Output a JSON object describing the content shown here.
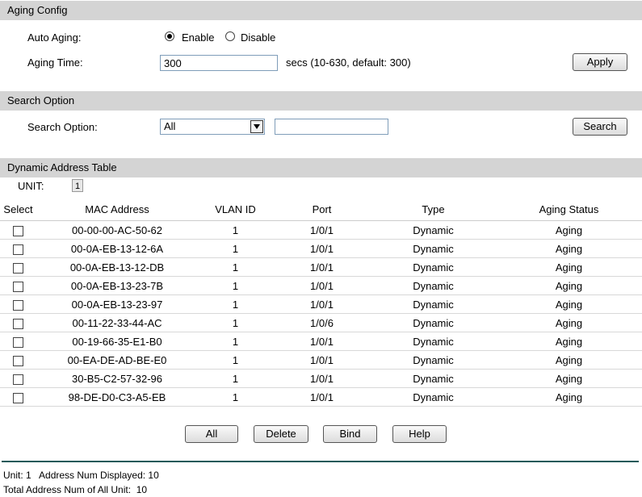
{
  "aging_config": {
    "header": "Aging Config",
    "auto_aging_label": "Auto Aging:",
    "enable_label": "Enable",
    "disable_label": "Disable",
    "auto_aging_selected": "Enable",
    "aging_time_label": "Aging Time:",
    "aging_time_value": "300",
    "aging_time_hint": "secs (10-630, default: 300)",
    "apply_label": "Apply"
  },
  "search": {
    "header": "Search Option",
    "option_label": "Search Option:",
    "option_selected": "All",
    "search_value": "",
    "search_button": "Search"
  },
  "dynamic_table": {
    "header": "Dynamic Address Table",
    "unit_label": "UNIT:",
    "unit_value": "1",
    "columns": [
      "Select",
      "MAC Address",
      "VLAN ID",
      "Port",
      "Type",
      "Aging Status"
    ],
    "rows": [
      {
        "mac": "00-00-00-AC-50-62",
        "vlan": "1",
        "port": "1/0/1",
        "type": "Dynamic",
        "status": "Aging"
      },
      {
        "mac": "00-0A-EB-13-12-6A",
        "vlan": "1",
        "port": "1/0/1",
        "type": "Dynamic",
        "status": "Aging"
      },
      {
        "mac": "00-0A-EB-13-12-DB",
        "vlan": "1",
        "port": "1/0/1",
        "type": "Dynamic",
        "status": "Aging"
      },
      {
        "mac": "00-0A-EB-13-23-7B",
        "vlan": "1",
        "port": "1/0/1",
        "type": "Dynamic",
        "status": "Aging"
      },
      {
        "mac": "00-0A-EB-13-23-97",
        "vlan": "1",
        "port": "1/0/1",
        "type": "Dynamic",
        "status": "Aging"
      },
      {
        "mac": "00-11-22-33-44-AC",
        "vlan": "1",
        "port": "1/0/6",
        "type": "Dynamic",
        "status": "Aging"
      },
      {
        "mac": "00-19-66-35-E1-B0",
        "vlan": "1",
        "port": "1/0/1",
        "type": "Dynamic",
        "status": "Aging"
      },
      {
        "mac": "00-EA-DE-AD-BE-E0",
        "vlan": "1",
        "port": "1/0/1",
        "type": "Dynamic",
        "status": "Aging"
      },
      {
        "mac": "30-B5-C2-57-32-96",
        "vlan": "1",
        "port": "1/0/1",
        "type": "Dynamic",
        "status": "Aging"
      },
      {
        "mac": "98-DE-D0-C3-A5-EB",
        "vlan": "1",
        "port": "1/0/1",
        "type": "Dynamic",
        "status": "Aging"
      }
    ],
    "buttons": {
      "all": "All",
      "delete": "Delete",
      "bind": "Bind",
      "help": "Help"
    }
  },
  "footer": {
    "unit_line": "Unit: 1   Address Num Displayed: 10",
    "total_line": "Total Address Num of All Unit:  10"
  },
  "colors": {
    "section_header_bg": "#d4d4d4",
    "footer_line": "#1e5a5a"
  }
}
